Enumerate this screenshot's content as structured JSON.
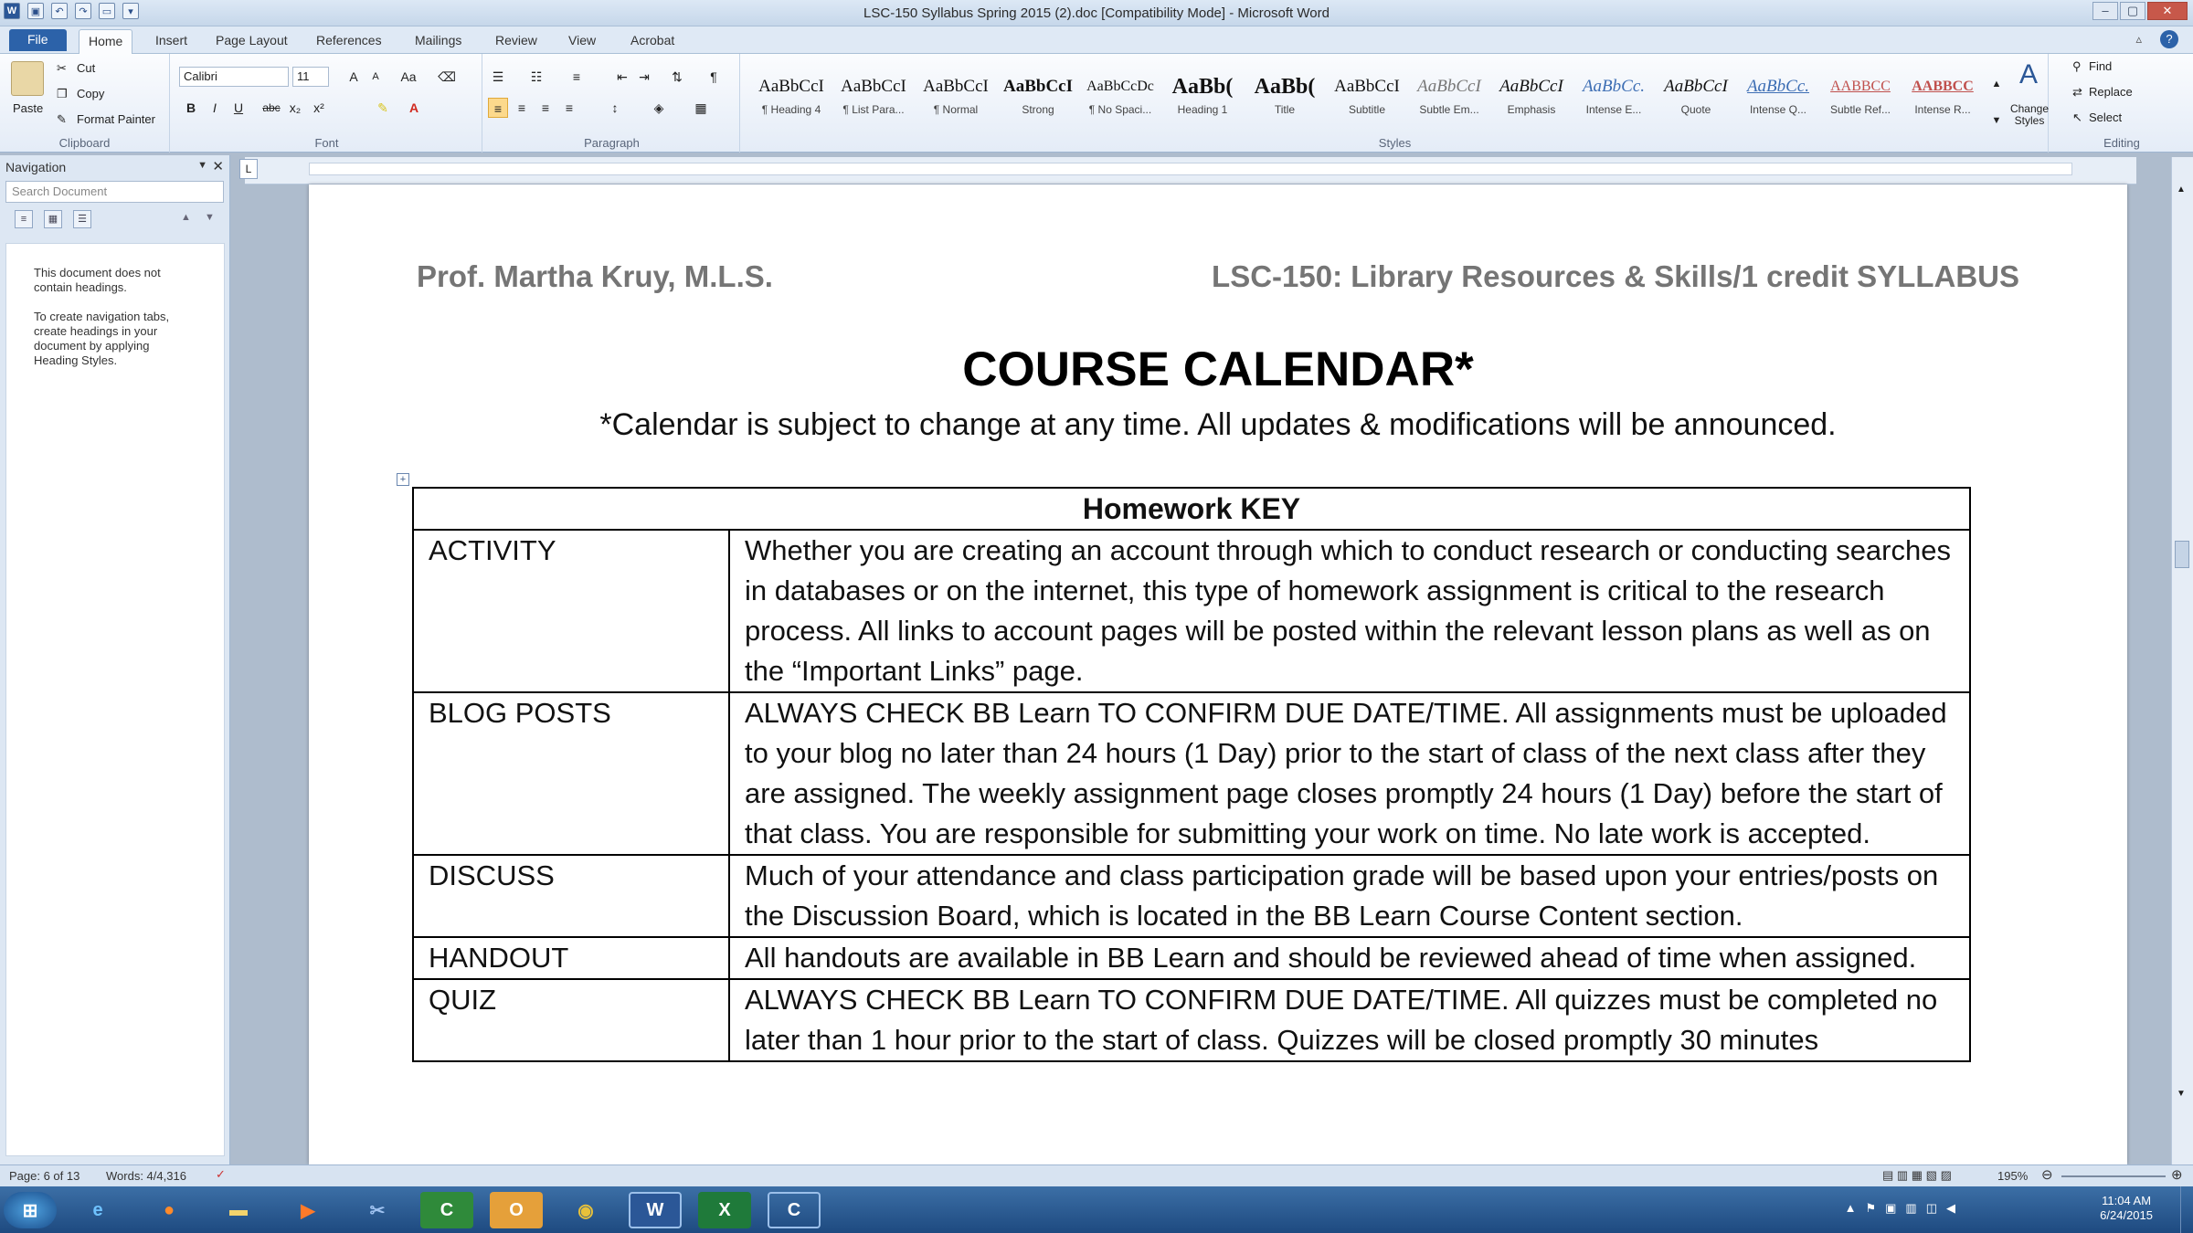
{
  "window": {
    "title": "LSC-150 Syllabus Spring 2015 (2).doc [Compatibility Mode] - Microsoft Word"
  },
  "tabs": [
    "File",
    "Home",
    "Insert",
    "Page Layout",
    "References",
    "Mailings",
    "Review",
    "View",
    "Acrobat"
  ],
  "clipboard": {
    "paste": "Paste",
    "cut": "Cut",
    "copy": "Copy",
    "format_painter": "Format Painter",
    "label": "Clipboard"
  },
  "font": {
    "name": "Calibri",
    "size": "11",
    "label": "Font"
  },
  "paragraph": {
    "label": "Paragraph"
  },
  "styles": {
    "label": "Styles",
    "change": "Change Styles",
    "items": [
      {
        "preview": "AaBbCcI",
        "name": "¶ Heading 4"
      },
      {
        "preview": "AaBbCcI",
        "name": "¶ List Para..."
      },
      {
        "preview": "AaBbCcI",
        "name": "¶ Normal"
      },
      {
        "preview": "AaBbCcI",
        "name": "Strong"
      },
      {
        "preview": "AaBbCcDc",
        "name": "¶ No Spaci..."
      },
      {
        "preview": "AaBb(",
        "name": "Heading 1"
      },
      {
        "preview": "AaBb(",
        "name": "Title"
      },
      {
        "preview": "AaBbCcI",
        "name": "Subtitle"
      },
      {
        "preview": "AaBbCcI",
        "name": "Subtle Em..."
      },
      {
        "preview": "AaBbCcI",
        "name": "Emphasis"
      },
      {
        "preview": "AaBbCc.",
        "name": "Intense E..."
      },
      {
        "preview": "AaBbCcI",
        "name": "Quote"
      },
      {
        "preview": "AaBbCc.",
        "name": "Intense Q..."
      },
      {
        "preview": "AABBCC",
        "name": "Subtle Ref..."
      },
      {
        "preview": "AABBCC",
        "name": "Intense R..."
      }
    ]
  },
  "editing": {
    "find": "Find",
    "replace": "Replace",
    "select": "Select",
    "label": "Editing"
  },
  "navigation": {
    "title": "Navigation",
    "search_placeholder": "Search Document",
    "msg1": "This document does not contain headings.",
    "msg2": "To create navigation tabs, create headings in your document by applying Heading Styles."
  },
  "document": {
    "header_left": "Prof. Martha Kruy, M.L.S.",
    "header_right": "LSC-150: Library Resources & Skills/1 credit SYLLABUS",
    "title": "COURSE CALENDAR*",
    "subtitle": "*Calendar is subject to change at any time. All updates & modifications will be announced.",
    "table": {
      "header": "Homework KEY",
      "rows": [
        {
          "key": "ACTIVITY",
          "text": "Whether you are creating an account through which to conduct research or conducting searches in databases or on the internet, this type of homework assignment is critical to the research process. All links to account pages will be posted within the relevant lesson plans as well as on the “Important Links” page."
        },
        {
          "key": "BLOG POSTS",
          "text": "ALWAYS CHECK BB Learn TO CONFIRM DUE DATE/TIME. All assignments must be uploaded to your blog no later than 24 hours (1 Day) prior to the start of class of the next class after they are assigned. The weekly assignment page closes promptly 24 hours (1 Day) before the start of that class. You are responsible for submitting your work on time. No late work is accepted."
        },
        {
          "key": "DISCUSS",
          "text": "Much of your attendance and class participation grade will be based upon your entries/posts on the Discussion Board, which is located in the BB Learn Course Content section."
        },
        {
          "key": "HANDOUT",
          "text": "All handouts are available in BB Learn and should be reviewed ahead of time when assigned."
        },
        {
          "key": "QUIZ",
          "text": "ALWAYS CHECK BB Learn TO CONFIRM DUE DATE/TIME. All quizzes must be completed no later than 1 hour prior to the start of class. Quizzes will be closed promptly 30 minutes"
        }
      ]
    }
  },
  "status": {
    "page": "Page: 6 of 13",
    "words": "Words: 4/4,316",
    "zoom": "195%"
  },
  "clock": {
    "time": "11:04 AM",
    "date": "6/24/2015"
  }
}
